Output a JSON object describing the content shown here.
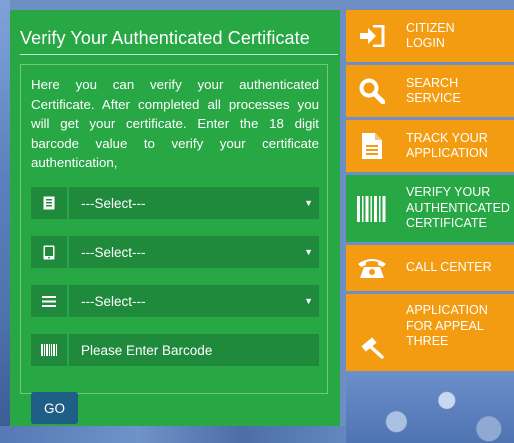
{
  "panel": {
    "title": "Verify Your Authenticated Certificate",
    "intro": "Here you can verify your authenticated Certificate. After completed all processes you will get your certificate. Enter the 18 digit barcode value to verify your certificate authentication,",
    "fields": [
      {
        "value": "---Select---",
        "icon": "document-icon"
      },
      {
        "value": "---Select---",
        "icon": "tablet-icon"
      },
      {
        "value": "---Select---",
        "icon": "list-icon"
      }
    ],
    "barcode_placeholder": "Please Enter Barcode",
    "go_label": "GO"
  },
  "menu": {
    "items": [
      {
        "label_line1": "CITIZEN",
        "label_line2": "LOGIN",
        "label_line3": "",
        "icon": "login-icon",
        "active": false
      },
      {
        "label_line1": "SEARCH",
        "label_line2": "SERVICE",
        "label_line3": "",
        "icon": "search-icon",
        "active": false
      },
      {
        "label_line1": "TRACK YOUR",
        "label_line2": "APPLICATION",
        "label_line3": "",
        "icon": "document-icon",
        "active": false
      },
      {
        "label_line1": "VERIFY YOUR",
        "label_line2": "AUTHENTICATED",
        "label_line3": "CERTIFICATE",
        "icon": "barcode-icon",
        "active": true
      },
      {
        "label_line1": "CALL CENTER",
        "label_line2": "",
        "label_line3": "",
        "icon": "phone-icon",
        "active": false
      },
      {
        "label_line1": "APPLICATION",
        "label_line2": "FOR APPEAL",
        "label_line3": "THREE",
        "icon": "gavel-icon",
        "active": false
      }
    ]
  },
  "colors": {
    "panel_green": "#28a745",
    "field_green": "#1f8a3c",
    "menu_orange": "#f39c12",
    "go_button": "#1f5f87"
  }
}
